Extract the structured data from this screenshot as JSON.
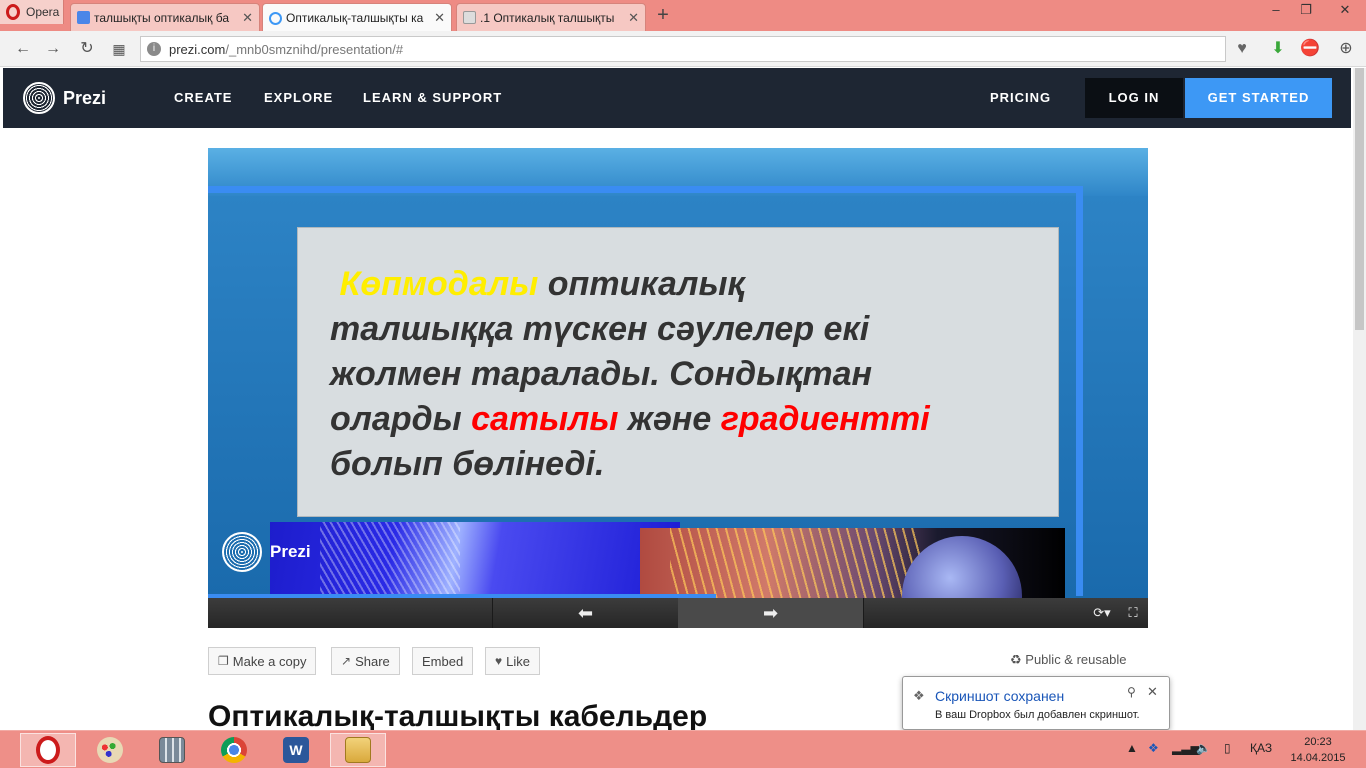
{
  "browser": {
    "app_label": "Opera",
    "tabs": [
      {
        "label": "талшықты оптикалық ба",
        "active": false
      },
      {
        "label": "Оптикалық-талшықты ка",
        "active": true
      },
      {
        "label": ".1 Оптикалық талшықты",
        "active": false
      }
    ],
    "new_tab_symbol": "+",
    "address": {
      "host": "prezi.com",
      "path": "/_mnb0smznihd/presentation/#"
    }
  },
  "prezi_header": {
    "logo_text": "Prezi",
    "nav": [
      "CREATE",
      "EXPLORE",
      "LEARN & SUPPORT"
    ],
    "pricing": "PRICING",
    "login": "LOG IN",
    "get_started": "GET STARTED"
  },
  "slide": {
    "highlight_yellow": "Көпмодалы",
    "line1_rest": " оптикалық",
    "line2": "талшыққа түскен сәулелер екі",
    "line3": "жолмен таралады. Сондықтан",
    "line4_a": "оларды ",
    "line4_red1": "сатылы",
    "line4_b": " және ",
    "line4_red2": "градиентті",
    "line5": "болып бөлінеді.",
    "viewer_logo_text": "Prezi",
    "progress": 0.54
  },
  "actions": {
    "make_copy": "Make a copy",
    "share": "Share",
    "embed": "Embed",
    "like": "Like",
    "public_reusable": "Public & reusable"
  },
  "page_title": "Оптикалық-талшықты кабельдер",
  "notification": {
    "title": "Скриншот сохранен",
    "body": "В ваш Dropbox был добавлен скриншот."
  },
  "taskbar": {
    "language": "ҚАЗ",
    "time": "20:23",
    "date": "14.04.2015"
  },
  "colors": {
    "tab_strip": "#ee8b84",
    "prezi_header": "#1e2633",
    "get_started": "#3d98f5",
    "slide_yellow": "#ffee00",
    "slide_red": "#ff0000",
    "taskbar": "#ee8f88"
  }
}
